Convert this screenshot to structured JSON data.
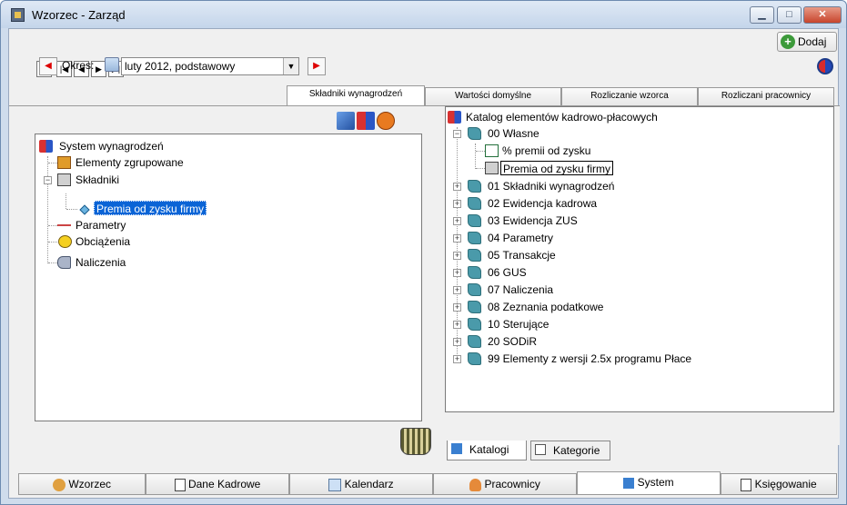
{
  "window": {
    "title": "Wzorzec - Zarząd"
  },
  "toolbar": {
    "nav": [
      "D",
      "|◀",
      "◀",
      "▶",
      "▶|"
    ],
    "add_label": "Dodaj"
  },
  "period": {
    "label": "Okres:",
    "value": "luty 2012, podstawowy"
  },
  "tabs": [
    "Składniki wynagrodzeń",
    "Wartości domyślne",
    "Rozliczanie wzorca",
    "Rozliczani pracownicy"
  ],
  "left_tree": {
    "root": "System wynagrodzeń",
    "items": [
      "Elementy zgrupowane",
      "Składniki",
      "Premia od zysku firmy",
      "Parametry",
      "Obciążenia",
      "Naliczenia"
    ]
  },
  "right_tree": {
    "root": "Katalog elementów kadrowo-płacowych",
    "group0": "00 Własne",
    "group0_children": [
      "% premii od zysku",
      "Premia od zysku firmy"
    ],
    "groups": [
      "01 Składniki wynagrodzeń",
      "02 Ewidencja kadrowa",
      "03 Ewidencja ZUS",
      "04 Parametry",
      "05 Transakcje",
      "06 GUS",
      "07 Naliczenia",
      "08 Zeznania podatkowe",
      "10 Sterujące",
      "20 SODiR",
      "99 Elementy z wersji 2.5x programu Płace"
    ]
  },
  "subtabs": [
    "Katalogi",
    "Kategorie"
  ],
  "bottom_tabs": [
    "Wzorzec",
    "Dane Kadrowe",
    "Kalendarz",
    "Pracownicy",
    "System",
    "Księgowanie"
  ]
}
